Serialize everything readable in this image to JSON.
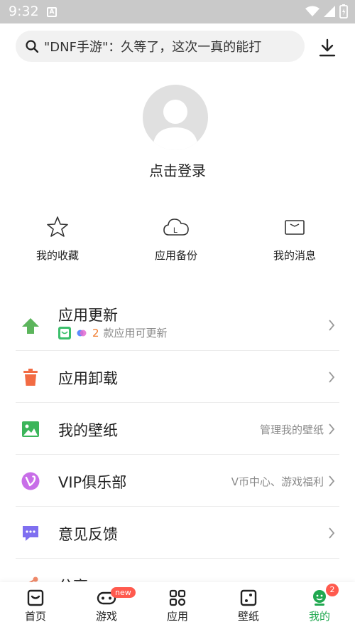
{
  "status_bar": {
    "time": "9:32"
  },
  "search": {
    "text": "\"DNF手游\"：久等了，这次一真的能打"
  },
  "profile": {
    "login_label": "点击登录"
  },
  "quick_actions": [
    {
      "label": "我的收藏",
      "icon": "star-icon"
    },
    {
      "label": "应用备份",
      "icon": "cloud-backup-icon"
    },
    {
      "label": "我的消息",
      "icon": "message-icon"
    }
  ],
  "menu": {
    "update": {
      "title": "应用更新",
      "count": "2",
      "count_text": "款应用可更新"
    },
    "uninstall": {
      "title": "应用卸载"
    },
    "wallpaper": {
      "title": "我的壁纸",
      "right": "管理我的壁纸"
    },
    "vip": {
      "title": "VIP俱乐部",
      "right": "V币中心、游戏福利"
    },
    "feedback": {
      "title": "意见反馈"
    },
    "share": {
      "title": "分享"
    }
  },
  "tabs": [
    {
      "label": "首页"
    },
    {
      "label": "游戏",
      "badge": "new"
    },
    {
      "label": "应用"
    },
    {
      "label": "壁纸"
    },
    {
      "label": "我的",
      "badge": "2"
    }
  ],
  "colors": {
    "accent": "#20a84f",
    "badge": "#ff5a4e",
    "update_count": "#f07a2b"
  }
}
